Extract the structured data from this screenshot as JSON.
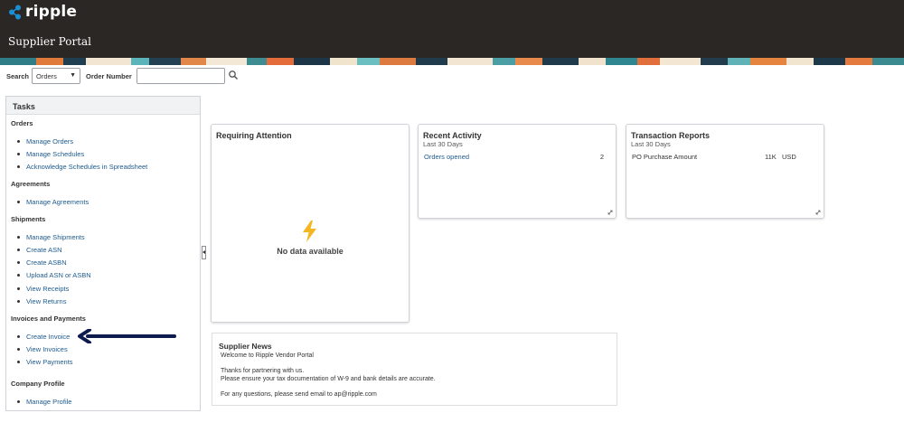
{
  "header": {
    "logo_text": "ripple",
    "portal_title": "Supplier Portal"
  },
  "search": {
    "label": "Search",
    "selected": "Orders",
    "order_number_label": "Order Number",
    "order_number_value": ""
  },
  "tasks": {
    "title": "Tasks",
    "groups": [
      {
        "label": "Orders",
        "items": [
          "Manage Orders",
          "Manage Schedules",
          "Acknowledge Schedules in Spreadsheet"
        ]
      },
      {
        "label": "Agreements",
        "items": [
          "Manage Agreements"
        ]
      },
      {
        "label": "Shipments",
        "items": [
          "Manage Shipments",
          "Create ASN",
          "Create ASBN",
          "Upload ASN or ASBN",
          "View Receipts",
          "View Returns"
        ]
      },
      {
        "label": "Invoices and Payments",
        "items": [
          "Create Invoice",
          "View Invoices",
          "View Payments"
        ]
      },
      {
        "label": "Company Profile",
        "items": [
          "Manage Profile"
        ]
      }
    ]
  },
  "requiring_attention": {
    "title": "Requiring Attention",
    "empty_text": "No data available"
  },
  "recent_activity": {
    "title": "Recent Activity",
    "subtitle": "Last 30 Days",
    "rows": [
      {
        "label": "Orders opened",
        "value": "2"
      }
    ]
  },
  "transaction_reports": {
    "title": "Transaction Reports",
    "subtitle": "Last 30 Days",
    "rows": [
      {
        "label": "PO Purchase Amount",
        "value": "11K",
        "unit": "USD"
      }
    ]
  },
  "supplier_news": {
    "title": "Supplier News",
    "lines": [
      "Welcome to Ripple Vendor Portal",
      "Thanks for partnering with us.",
      "Please ensure your tax documentation of W-9 and bank details are accurate.",
      "For any questions, please send email to ap@ripple.com"
    ]
  },
  "colors": {
    "header_bg": "#2b2724",
    "link": "#1d5a8e",
    "arrow": "#0d1b4f",
    "bolt": "#f5b621"
  },
  "icons": {
    "logo": "ripple-logo-icon",
    "search": "search-icon",
    "bolt": "lightning-bolt-icon",
    "resize": "expand-icon",
    "annotation": "arrow-left-icon"
  }
}
